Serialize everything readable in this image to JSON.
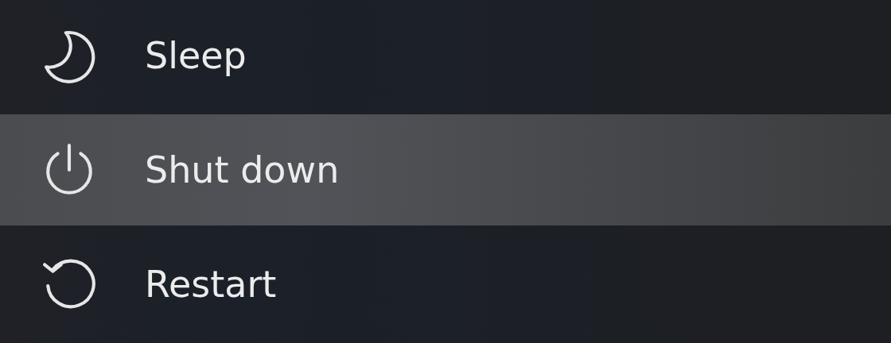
{
  "power_menu": {
    "items": [
      {
        "label": "Sleep",
        "kind": "sleep",
        "selected": false
      },
      {
        "label": "Shut down",
        "kind": "shutdown",
        "selected": true
      },
      {
        "label": "Restart",
        "kind": "restart",
        "selected": false
      }
    ]
  }
}
